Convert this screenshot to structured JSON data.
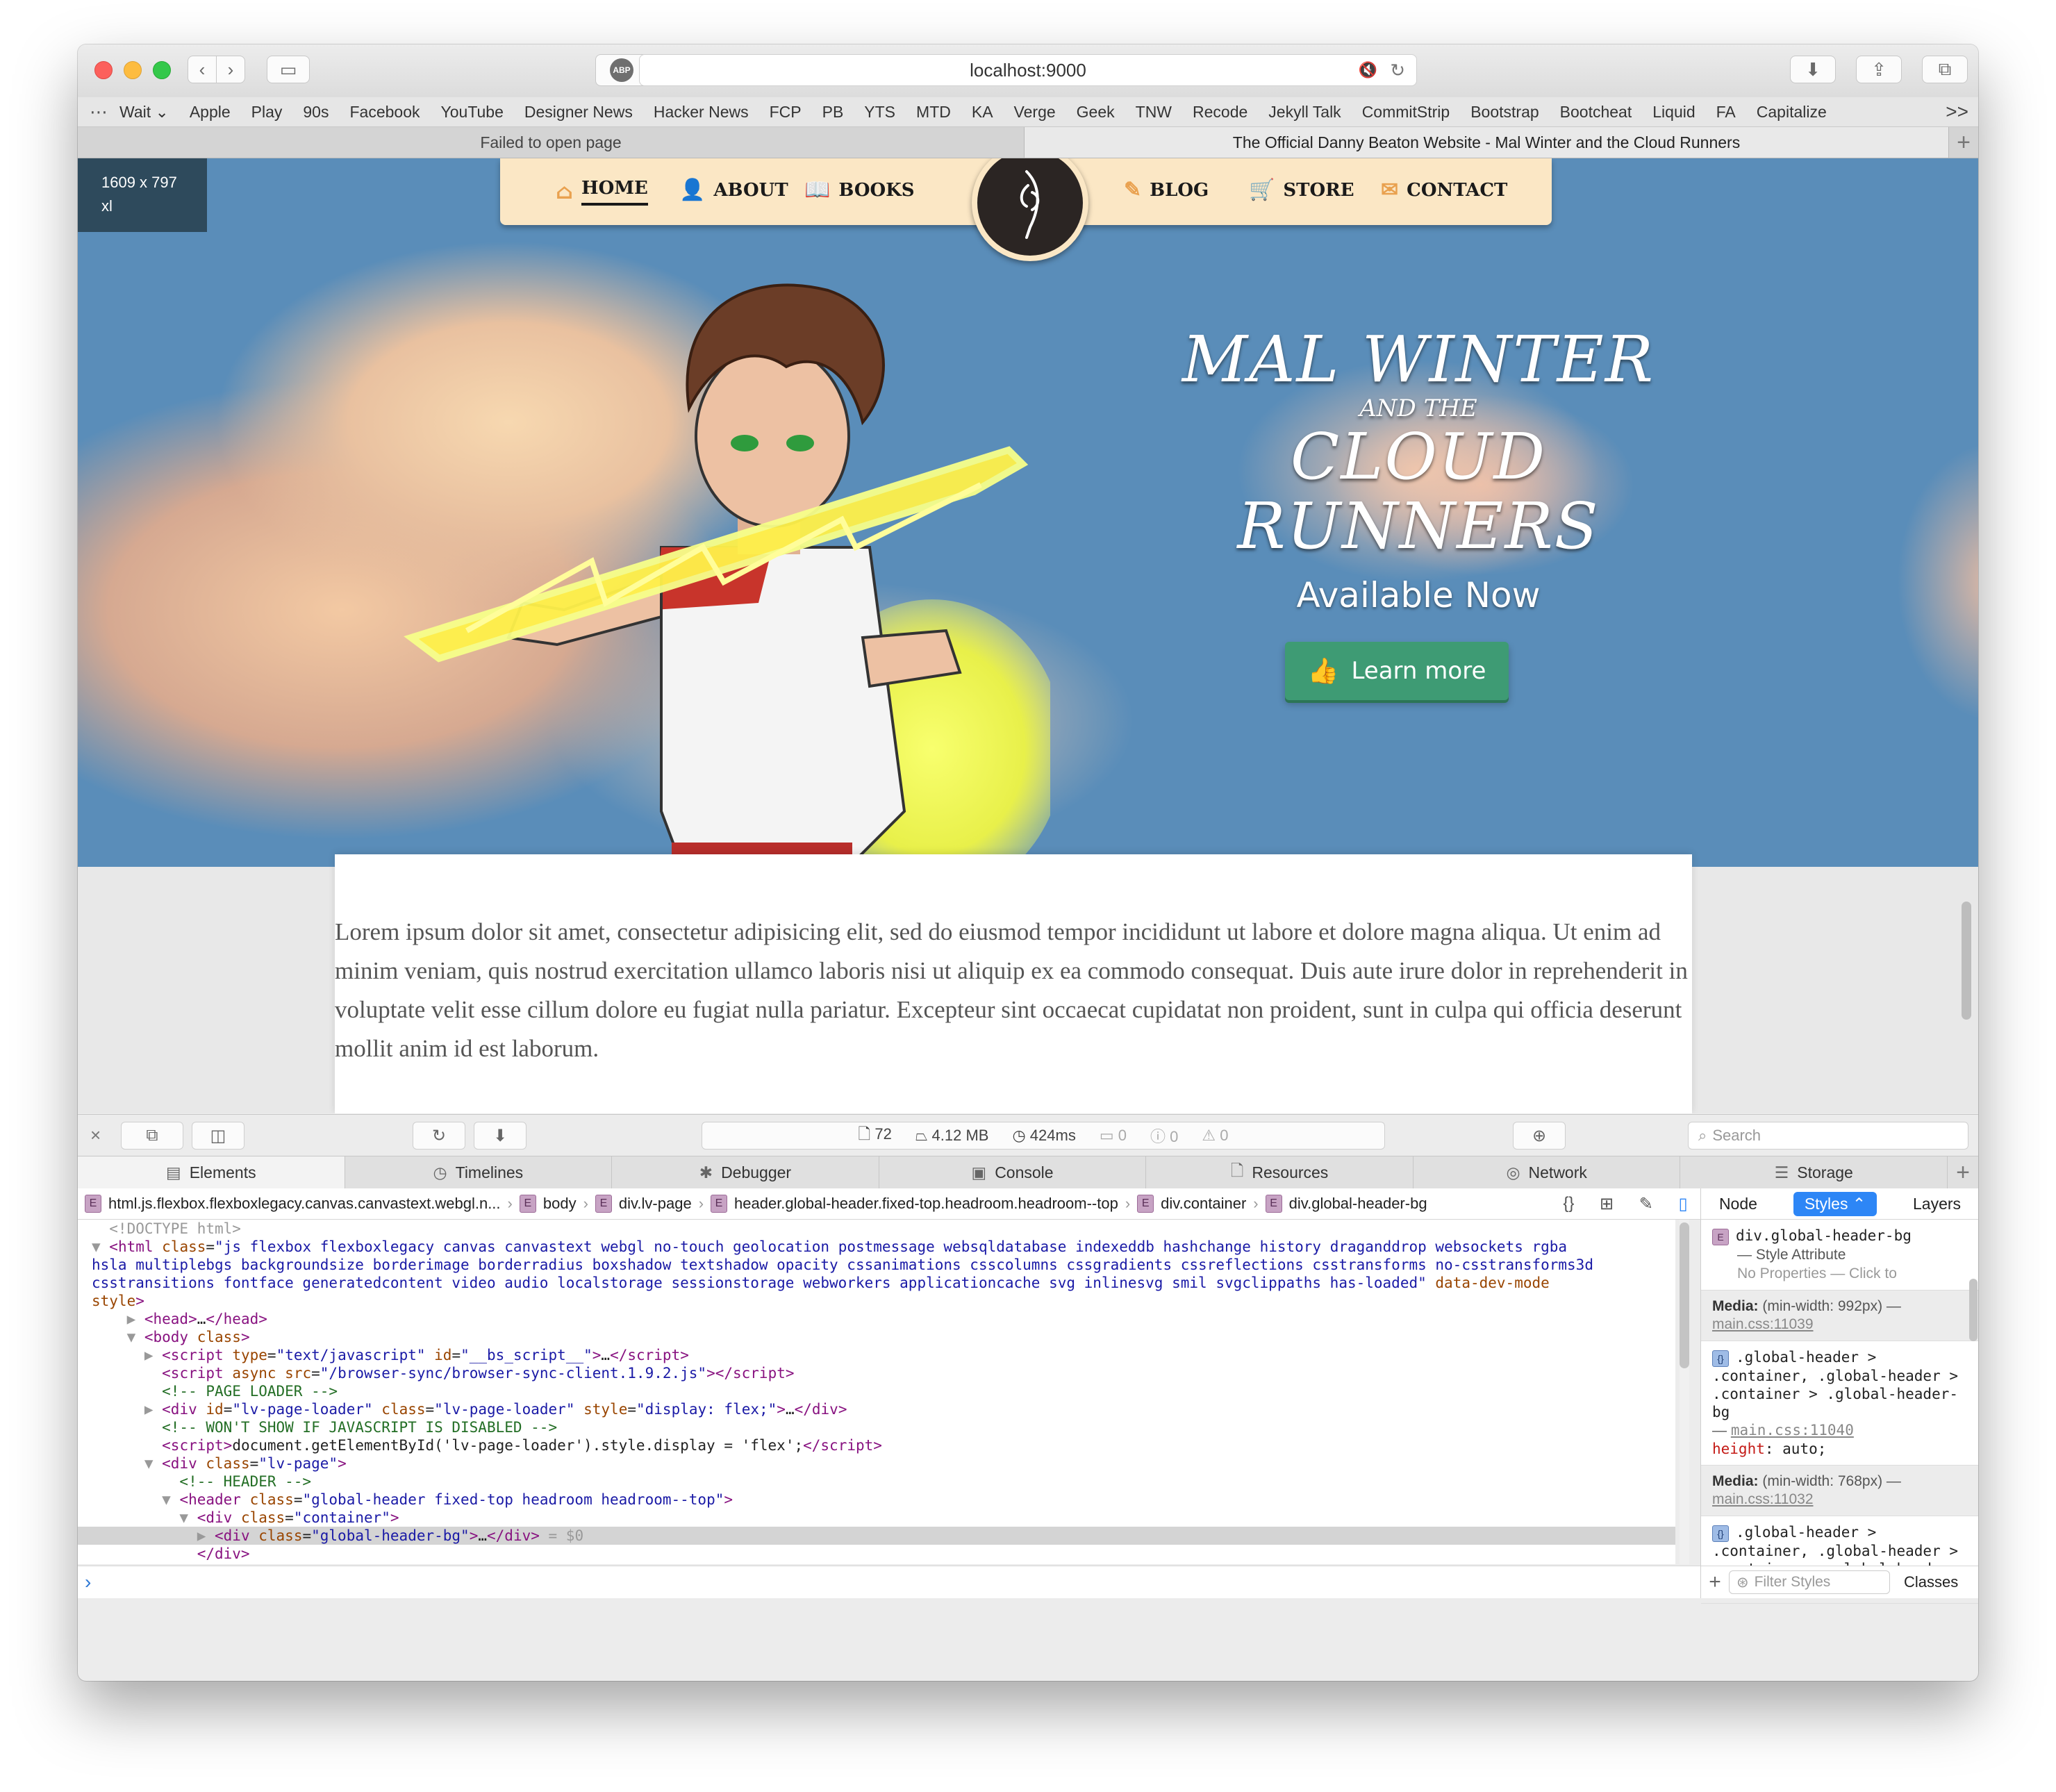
{
  "browser": {
    "url": "localhost:9000",
    "abp_label": "ABP",
    "bookmarks": [
      "Wait ⌄",
      "Apple",
      "Play",
      "90s",
      "Facebook",
      "YouTube",
      "Designer News",
      "Hacker News",
      "FCP",
      "PB",
      "YTS",
      "MTD",
      "KA",
      "Verge",
      "Geek",
      "TNW",
      "Recode",
      "Jekyll Talk",
      "CommitStrip",
      "Bootstrap",
      "Bootcheat",
      "Liquid",
      "FA",
      "Capitalize"
    ],
    "bookmarks_more": ">>",
    "tabs": [
      {
        "label": "Failed to open page",
        "active": false
      },
      {
        "label": "The Official Danny Beaton Website - Mal Winter and the Cloud Runners",
        "active": true
      }
    ]
  },
  "page": {
    "size_badge": {
      "dims": "1609 x 797",
      "breakpoint": "xl"
    },
    "nav": {
      "left": [
        {
          "label": "HOME",
          "icon": "home-icon"
        },
        {
          "label": "ABOUT",
          "icon": "user-icon"
        },
        {
          "label": "BOOKS",
          "icon": "book-icon"
        }
      ],
      "right": [
        {
          "label": "BLOG",
          "icon": "pen-icon"
        },
        {
          "label": "STORE",
          "icon": "cart-icon"
        },
        {
          "label": "CONTACT",
          "icon": "envelope-icon"
        }
      ]
    },
    "hero": {
      "title_line1": "MAL WINTER",
      "title_line2": "AND THE",
      "title_line3": "CLOUD RUNNERS",
      "subtitle": "Available Now",
      "button_label": "Learn more"
    },
    "body_text": "Lorem ipsum dolor sit amet, consectetur adipisicing elit, sed do eiusmod tempor incididunt ut labore et dolore magna aliqua. Ut enim ad minim veniam, quis nostrud exercitation ullamco laboris nisi ut aliquip ex ea commodo consequat. Duis aute irure dolor in reprehenderit in voluptate velit esse cillum dolore eu fugiat nulla pariatur. Excepteur sint occaecat cupidatat non proident, sunt in culpa qui officia deserunt mollit anim id est laborum."
  },
  "devtools": {
    "metrics": {
      "resources": "72",
      "size": "4.12 MB",
      "time": "424ms",
      "logs": "0",
      "errors": "0",
      "warnings": "0"
    },
    "search_placeholder": "Search",
    "tabs": [
      "Elements",
      "Timelines",
      "Debugger",
      "Console",
      "Resources",
      "Network",
      "Storage"
    ],
    "breadcrumbs": [
      "html.js.flexbox.flexboxlegacy.canvas.canvastext.webgl.n...",
      "body",
      "div.lv-page",
      "header.global-header.fixed-top.headroom.headroom--top",
      "div.container",
      "div.global-header-bg"
    ],
    "sidebar": {
      "tabs": [
        "Node",
        "Styles ⌃",
        "Layers"
      ],
      "element": "div.global-header-bg",
      "style_attr": "— Style Attribute",
      "no_props": "No Properties — Click to",
      "media1_label": "Media:",
      "media1_query": "(min-width: 992px) —",
      "media1_link": "main.css:11039",
      "rule1_selector": ".global-header > .container, .global-header > .container > .global-header-bg",
      "rule1_link": "main.css:11040",
      "rule1_prop": "height",
      "rule1_value": "auto;",
      "media2_label": "Media:",
      "media2_query": "(min-width: 768px) —",
      "media2_link": "main.css:11032",
      "rule2_selector": ".global-header > .container, .global-header > .container > .global-header-bg",
      "filter_placeholder": "Filter Styles",
      "classes_label": "Classes"
    }
  }
}
